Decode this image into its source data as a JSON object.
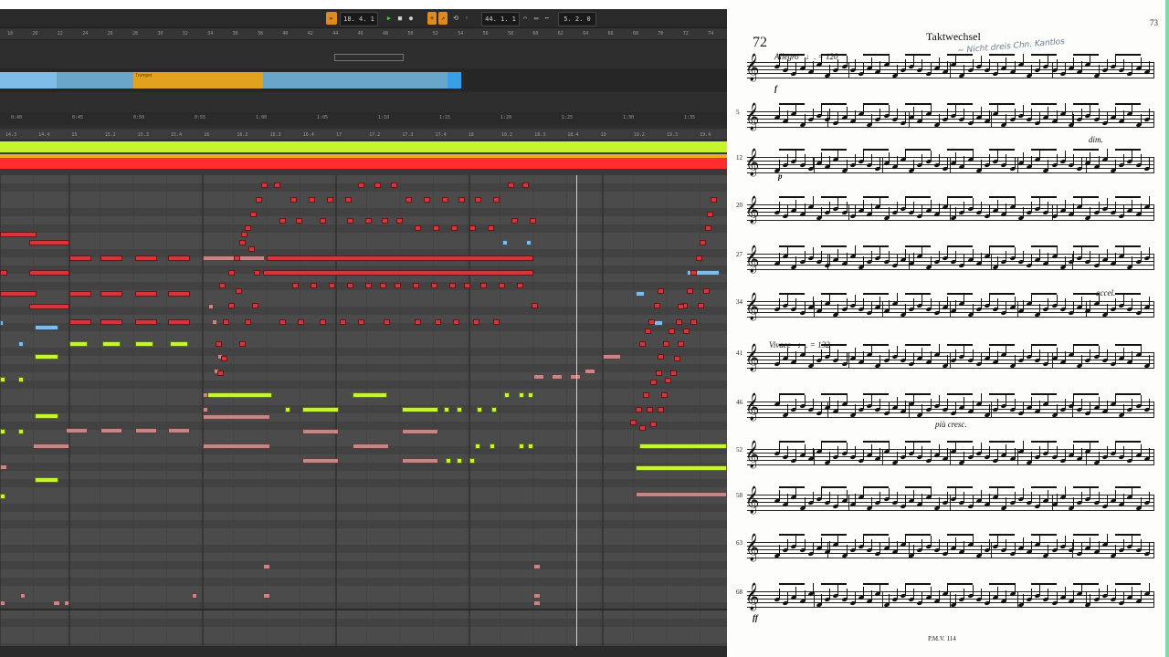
{
  "transport": {
    "position": "18. 4. 1",
    "loop_length": "44. 1. 1",
    "end_position": "5. 2. 0"
  },
  "arrangement": {
    "clip_name": "Trumpet",
    "bar_numbers": [
      "18",
      "20",
      "22",
      "24",
      "26",
      "28",
      "30",
      "32",
      "34",
      "36",
      "38",
      "40",
      "42",
      "44",
      "46",
      "48",
      "50",
      "52",
      "54",
      "56",
      "58",
      "60",
      "62",
      "64",
      "66",
      "68",
      "70",
      "72",
      "74"
    ],
    "time_marks": [
      "0:40",
      "0:45",
      "0:50",
      "0:55",
      "1:00",
      "1:05",
      "1:10",
      "1:15",
      "1:20",
      "1:25",
      "1:30",
      "1:35"
    ]
  },
  "loop_ruler": [
    "14.3",
    "14.4",
    "15",
    "15.2",
    "15.3",
    "15.4",
    "16",
    "16.2",
    "16.3",
    "16.4",
    "17",
    "17.2",
    "17.3",
    "17.4",
    "18",
    "18.2",
    "18.3",
    "18.4",
    "19",
    "19.2",
    "19.3",
    "19.4"
  ],
  "colors": {
    "red_note": "#d9343a",
    "pink_note": "#c78586",
    "yellow_note": "#c5f52c",
    "blue_note": "#7fbde8",
    "orange_clip": "#e2a21e",
    "playhead": "#cfcfcf"
  },
  "sheet": {
    "page_number": "73",
    "exercise_number": "72",
    "title": "Taktwechsel",
    "tempo1": "Allegro",
    "tempo1_metronome": "♩. = 120",
    "tempo2": "Vivace",
    "tempo2_metronome": "♩. = 132",
    "markings": {
      "dim": "dim.",
      "accel": "accel.",
      "piu_cresc": "più cresc.",
      "f": "f",
      "p": "p",
      "ff": "ff"
    },
    "measure_numbers": [
      "5",
      "12",
      "20",
      "27",
      "34",
      "41",
      "46",
      "52",
      "58",
      "63",
      "68"
    ],
    "footer": "P.M.V. 114"
  }
}
